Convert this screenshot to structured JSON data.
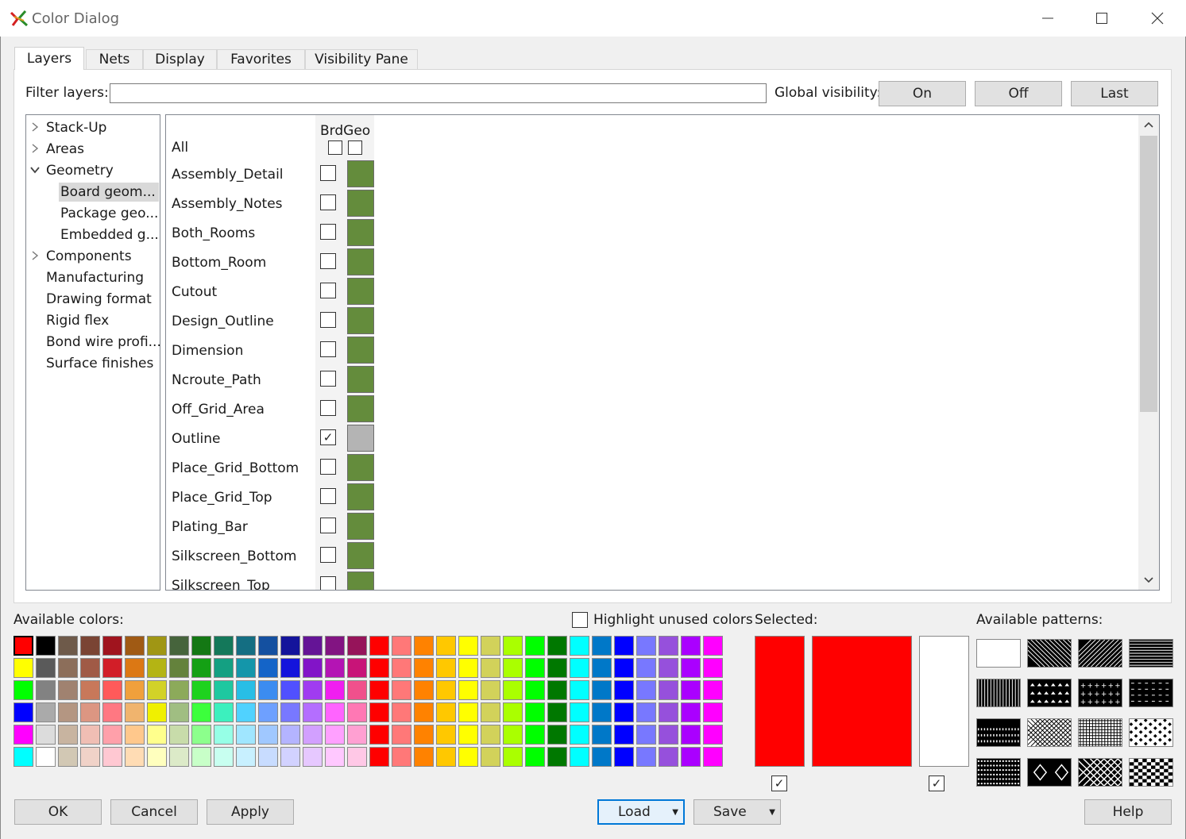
{
  "window": {
    "title": "Color Dialog",
    "controls": [
      "minimize",
      "maximize",
      "close"
    ]
  },
  "tabs": [
    {
      "label": "Layers",
      "active": true
    },
    {
      "label": "Nets",
      "active": false
    },
    {
      "label": "Display",
      "active": false
    },
    {
      "label": "Favorites",
      "active": false
    },
    {
      "label": "Visibility Pane",
      "active": false
    }
  ],
  "filter": {
    "label": "Filter layers:",
    "value": ""
  },
  "global_visibility": {
    "label": "Global visibility:",
    "buttons": [
      "On",
      "Off",
      "Last"
    ]
  },
  "tree": [
    {
      "label": "Stack-Up",
      "expander": "collapsed",
      "level": 0
    },
    {
      "label": "Areas",
      "expander": "collapsed",
      "level": 0
    },
    {
      "label": "Geometry",
      "expander": "expanded",
      "level": 0
    },
    {
      "label": "Board geom...",
      "expander": "none",
      "level": 1,
      "selected": true
    },
    {
      "label": "Package geo...",
      "expander": "none",
      "level": 1
    },
    {
      "label": "Embedded g...",
      "expander": "none",
      "level": 1
    },
    {
      "label": "Components",
      "expander": "collapsed",
      "level": 0
    },
    {
      "label": "Manufacturing",
      "expander": "none",
      "level": 0
    },
    {
      "label": "Drawing format",
      "expander": "none",
      "level": 0
    },
    {
      "label": "Rigid flex",
      "expander": "none",
      "level": 0
    },
    {
      "label": "Bond wire profi...",
      "expander": "none",
      "level": 0
    },
    {
      "label": "Surface finishes",
      "expander": "none",
      "level": 0
    }
  ],
  "grid": {
    "column_header": "BrdGeo",
    "all_label": "All",
    "layers": [
      {
        "name": "Assembly_Detail",
        "visible": false,
        "color": "#648c3c"
      },
      {
        "name": "Assembly_Notes",
        "visible": false,
        "color": "#648c3c"
      },
      {
        "name": "Both_Rooms",
        "visible": false,
        "color": "#648c3c"
      },
      {
        "name": "Bottom_Room",
        "visible": false,
        "color": "#648c3c"
      },
      {
        "name": "Cutout",
        "visible": false,
        "color": "#648c3c"
      },
      {
        "name": "Design_Outline",
        "visible": false,
        "color": "#648c3c"
      },
      {
        "name": "Dimension",
        "visible": false,
        "color": "#648c3c"
      },
      {
        "name": "Ncroute_Path",
        "visible": false,
        "color": "#648c3c"
      },
      {
        "name": "Off_Grid_Area",
        "visible": false,
        "color": "#648c3c"
      },
      {
        "name": "Outline",
        "visible": true,
        "color": "#b4b4b4"
      },
      {
        "name": "Place_Grid_Bottom",
        "visible": false,
        "color": "#648c3c"
      },
      {
        "name": "Place_Grid_Top",
        "visible": false,
        "color": "#648c3c"
      },
      {
        "name": "Plating_Bar",
        "visible": false,
        "color": "#648c3c"
      },
      {
        "name": "Silkscreen_Bottom",
        "visible": false,
        "color": "#648c3c"
      },
      {
        "name": "Silkscreen_Top",
        "visible": false,
        "color": "#648c3c"
      }
    ]
  },
  "available_colors": {
    "label": "Available colors:",
    "highlight_label": "Highlight unused colors",
    "highlight_checked": false,
    "rows": [
      [
        "#ff0000",
        "#000000",
        "#6e5a4a",
        "#7a4434",
        "#a0141e",
        "#a05a14",
        "#a09614",
        "#46643c",
        "#147814",
        "#14785a",
        "#146e82",
        "#1450a0",
        "#14149b",
        "#641496",
        "#821482",
        "#96145a",
        "#ff0000",
        "#ff7878",
        "#ff8200",
        "#ffc800",
        "#ffff00",
        "#d2d25a",
        "#aaff00",
        "#00ff00",
        "#007800",
        "#00ffff",
        "#0078c8",
        "#0000ff",
        "#7878ff",
        "#9650dc",
        "#aa00ff",
        "#ff00ff"
      ],
      [
        "#ffff00",
        "#5a5a5a",
        "#8c6e5a",
        "#a05a46",
        "#d21e28",
        "#dc7814",
        "#b4b414",
        "#64823c",
        "#14a014",
        "#14a082",
        "#1496aa",
        "#1464c8",
        "#1414dc",
        "#8214c8",
        "#b414b4",
        "#c81478",
        "#ff0000",
        "#ff7878",
        "#ff8200",
        "#ffc800",
        "#ffff00",
        "#d2d25a",
        "#aaff00",
        "#00ff00",
        "#007800",
        "#00ffff",
        "#0078c8",
        "#0000ff",
        "#7878ff",
        "#9650dc",
        "#aa00ff",
        "#ff00ff"
      ],
      [
        "#00ff00",
        "#828282",
        "#a08270",
        "#c8785a",
        "#ff5a5a",
        "#f0a03c",
        "#d2d228",
        "#8caa5a",
        "#1ed21e",
        "#1ec8a0",
        "#28bee6",
        "#3c8cf0",
        "#5050ff",
        "#a03cf0",
        "#f01ef0",
        "#f0508c",
        "#ff0000",
        "#ff7878",
        "#ff8200",
        "#ffc800",
        "#ffff00",
        "#d2d25a",
        "#aaff00",
        "#00ff00",
        "#007800",
        "#00ffff",
        "#0078c8",
        "#0000ff",
        "#7878ff",
        "#9650dc",
        "#aa00ff",
        "#ff00ff"
      ],
      [
        "#0000ff",
        "#aaaaaa",
        "#b49682",
        "#dc9682",
        "#ff7882",
        "#f0b46e",
        "#f0f000",
        "#a0be82",
        "#3cff3c",
        "#3cf0be",
        "#50d2ff",
        "#6ea0ff",
        "#7878ff",
        "#b46eff",
        "#ff64ff",
        "#ff78b4",
        "#ff0000",
        "#ff7878",
        "#ff8200",
        "#ffc800",
        "#ffff00",
        "#d2d25a",
        "#aaff00",
        "#00ff00",
        "#007800",
        "#00ffff",
        "#0078c8",
        "#0000ff",
        "#7878ff",
        "#9650dc",
        "#aa00ff",
        "#ff00ff"
      ],
      [
        "#ff00ff",
        "#dcdcdc",
        "#c8b4a0",
        "#f0beb4",
        "#ffa0aa",
        "#ffc88c",
        "#ffff8c",
        "#c8dcaa",
        "#8cff8c",
        "#96ffe6",
        "#a0e6ff",
        "#a0c8ff",
        "#b4b4ff",
        "#d2a0ff",
        "#ffa0ff",
        "#ffa0d2",
        "#ff0000",
        "#ff7878",
        "#ff8200",
        "#ffc800",
        "#ffff00",
        "#d2d25a",
        "#aaff00",
        "#00ff00",
        "#007800",
        "#00ffff",
        "#0078c8",
        "#0000ff",
        "#7878ff",
        "#9650dc",
        "#aa00ff",
        "#ff00ff"
      ],
      [
        "#00ffff",
        "#ffffff",
        "#d2c8b4",
        "#f0d2c8",
        "#ffc8d2",
        "#ffdcb4",
        "#ffffbe",
        "#dceac8",
        "#c8ffc8",
        "#c8fff0",
        "#c8f0ff",
        "#c8dcff",
        "#d2d2ff",
        "#e6c8ff",
        "#ffc8ff",
        "#ffc8e6",
        "#ff0000",
        "#ff7878",
        "#ff8200",
        "#ffc800",
        "#ffff00",
        "#d2d25a",
        "#aaff00",
        "#00ff00",
        "#007800",
        "#00ffff",
        "#0078c8",
        "#0000ff",
        "#7878ff",
        "#9650dc",
        "#aa00ff",
        "#ff00ff"
      ]
    ]
  },
  "selected": {
    "label": "Selected:",
    "color_small": "#ff0000",
    "color_large": "#ff0000",
    "color_background": "#ffffff",
    "check1": true,
    "check2": true
  },
  "patterns": {
    "label": "Available patterns:",
    "items": [
      "solid-white",
      "diag-back",
      "diag-fwd",
      "horizontal",
      "vertical",
      "dots-tri",
      "plus",
      "dashes",
      "dots-dense",
      "crosshatch-diag",
      "grid",
      "checker",
      "dots-fine",
      "diamond",
      "diamond-grid",
      "checker-fine"
    ]
  },
  "footer": {
    "ok": "OK",
    "cancel": "Cancel",
    "apply": "Apply",
    "load": "Load",
    "save": "Save",
    "help": "Help"
  }
}
